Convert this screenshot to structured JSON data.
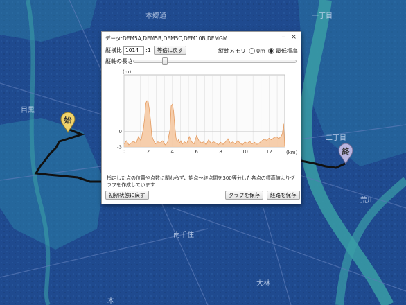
{
  "map": {
    "colors": {
      "low": "#1f4a8f",
      "mid": "#2a7fa8",
      "river": "#3a9ea6",
      "route": "#111111"
    },
    "labels": [
      "本郷通",
      "一丁目",
      "目黒",
      "二丁目",
      "荒川",
      "南千住",
      "大林",
      "木"
    ],
    "start_pin": {
      "label": "始",
      "color": "#f0d36a"
    },
    "end_pin": {
      "label": "終",
      "color": "#b8b5e0"
    }
  },
  "dialog": {
    "title": "データ:DEM5A,DEM5B,DEM5C,DEM10B,DEMGM",
    "minimize_glyph": "–",
    "close_glyph": "×",
    "ratio_label": "縦横比",
    "ratio_value": "1014",
    "ratio_suffix": ":1",
    "reset_ratio_button": "等倍に戻す",
    "axis_memory_label": "縦軸メモリ",
    "radio_zero": "0m",
    "radio_min": "最低標高",
    "axis_length_label": "縦軸の長さ",
    "description": "指定した点の位置や点数に関わらず、始点～終点間を300等分した各点の標高値よりグラフを作成しています",
    "reset_button": "初期状態に戻す",
    "save_graph_button": "グラフを保存",
    "save_route_button": "経路を保存"
  },
  "chart_data": {
    "type": "area",
    "ylabel": "(m)",
    "xlabel": "(km)",
    "xlim": [
      0,
      13.3
    ],
    "ylim": [
      -3,
      11
    ],
    "x_ticks": [
      0,
      2,
      4,
      6,
      8,
      10,
      12
    ],
    "y_ticks": [
      -3,
      0
    ],
    "fill_color": "#f5c9a3",
    "line_color": "#e39a5f",
    "x": [
      0,
      0.2,
      0.4,
      0.6,
      0.8,
      1.0,
      1.2,
      1.4,
      1.6,
      1.7,
      1.8,
      1.9,
      2.0,
      2.1,
      2.2,
      2.3,
      2.4,
      2.5,
      2.6,
      2.8,
      3.0,
      3.2,
      3.4,
      3.6,
      3.8,
      3.9,
      4.0,
      4.1,
      4.2,
      4.3,
      4.4,
      4.5,
      4.6,
      4.7,
      4.8,
      5.0,
      5.2,
      5.4,
      5.6,
      5.8,
      6.0,
      6.2,
      6.4,
      6.6,
      6.8,
      7.0,
      7.2,
      7.4,
      7.6,
      7.8,
      8.0,
      8.2,
      8.4,
      8.6,
      8.8,
      9.0,
      9.2,
      9.4,
      9.6,
      9.8,
      10.0,
      10.2,
      10.4,
      10.6,
      10.8,
      11.0,
      11.2,
      11.4,
      11.6,
      11.8,
      12.0,
      12.2,
      12.4,
      12.6,
      12.8,
      13.0,
      13.1,
      13.2,
      13.3
    ],
    "y": [
      -2.4,
      -1.8,
      -2.6,
      -2.2,
      -1.9,
      -2.3,
      -1.0,
      -1.8,
      0.5,
      2.5,
      5.5,
      6.0,
      5.8,
      4.2,
      2.0,
      -0.8,
      -1.5,
      -2.0,
      -2.4,
      -2.0,
      -2.2,
      -1.8,
      -2.6,
      -2.1,
      0.3,
      5.0,
      5.3,
      4.0,
      1.0,
      -1.2,
      -2.0,
      -1.6,
      -2.2,
      -1.8,
      -2.5,
      -2.0,
      -2.3,
      -1.0,
      -2.0,
      -2.4,
      -0.8,
      -1.8,
      -2.2,
      -2.0,
      -2.6,
      -1.6,
      -2.3,
      -2.0,
      -2.2,
      -2.6,
      -2.1,
      -2.5,
      -2.0,
      -1.4,
      -2.3,
      -2.0,
      -2.4,
      -1.8,
      -2.2,
      -2.6,
      -2.0,
      -2.3,
      -1.9,
      -2.4,
      -2.1,
      -2.5,
      -2.2,
      -1.8,
      -1.5,
      -1.7,
      -1.3,
      -1.6,
      -1.2,
      -1.0,
      -1.4,
      -0.9,
      -0.5,
      1.5,
      -2.8
    ]
  }
}
